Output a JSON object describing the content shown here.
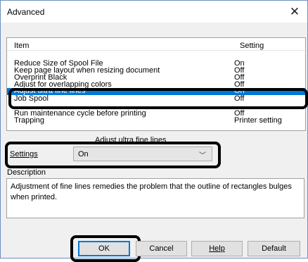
{
  "window": {
    "title": "Advanced",
    "close_icon": "close-icon"
  },
  "list": {
    "headers": {
      "item": "Item",
      "setting": "Setting"
    },
    "rows": [
      {
        "name": "Reduce Size of Spool File",
        "value": "On"
      },
      {
        "name": "Keep page layout when resizing document",
        "value": "Off"
      },
      {
        "name": "Overprint Black",
        "value": "Off"
      },
      {
        "name": "Adjust for overlapping colors",
        "value": "Off"
      },
      {
        "name": "Adjust ultra fine lines",
        "value": "On",
        "selected": true
      },
      {
        "name": "Job Spool",
        "value": "Off"
      },
      {
        "name": "Run maintenance cycle before printing",
        "value": "Off"
      },
      {
        "name": "Trapping",
        "value": "Printer setting"
      }
    ]
  },
  "settings_group": {
    "caption": "Adjust ultra fine lines",
    "label": "Settings",
    "selected_value": "On"
  },
  "description": {
    "label": "Description",
    "text": "Adjustment of fine lines remedies the problem that the outline of rectangles bulges when printed."
  },
  "buttons": {
    "ok": "OK",
    "cancel": "Cancel",
    "help": "Help",
    "default": "Default"
  },
  "colors": {
    "selection": "#0078d7",
    "highlight_outline": "#000000"
  }
}
